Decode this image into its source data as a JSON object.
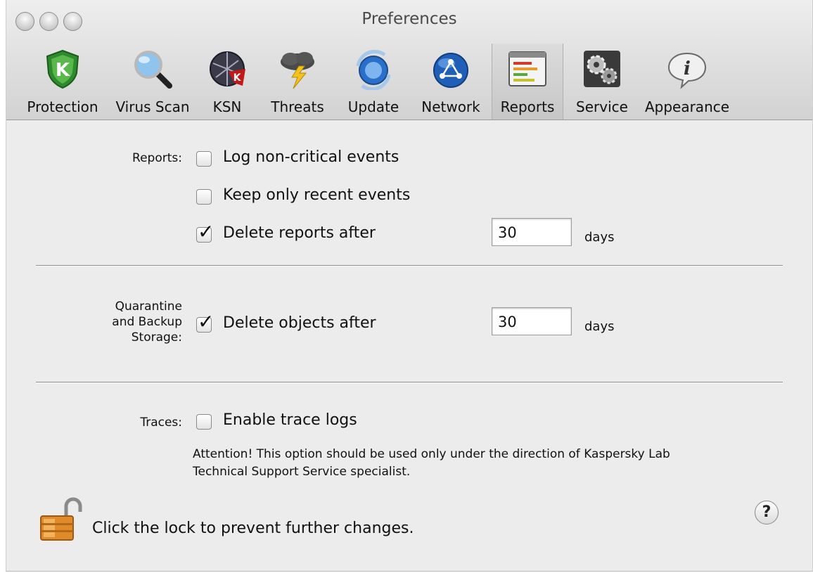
{
  "window": {
    "title": "Preferences"
  },
  "toolbar": {
    "items": [
      {
        "label": "Protection",
        "icon": "protection-shield-icon"
      },
      {
        "label": "Virus Scan",
        "icon": "magnifier-icon"
      },
      {
        "label": "KSN",
        "icon": "ksn-globe-icon"
      },
      {
        "label": "Threats",
        "icon": "storm-cloud-icon"
      },
      {
        "label": "Update",
        "icon": "update-globe-icon"
      },
      {
        "label": "Network",
        "icon": "network-icon"
      },
      {
        "label": "Reports",
        "icon": "reports-icon",
        "selected": true
      },
      {
        "label": "Service",
        "icon": "service-gears-icon"
      },
      {
        "label": "Appearance",
        "icon": "info-bubble-icon"
      }
    ]
  },
  "reports": {
    "label": "Reports:",
    "log_noncritical": {
      "label": "Log non-critical events",
      "checked": false
    },
    "keep_recent": {
      "label": "Keep only recent events",
      "checked": false
    },
    "delete_after": {
      "label": "Delete reports after",
      "checked": true,
      "value": "30",
      "unit": "days"
    }
  },
  "quarantine": {
    "label_lines": [
      "Quarantine",
      "and Backup",
      "Storage:"
    ],
    "delete_after": {
      "label": "Delete objects after",
      "checked": true,
      "value": "30",
      "unit": "days"
    }
  },
  "traces": {
    "label": "Traces:",
    "enable": {
      "label": "Enable trace logs",
      "checked": false
    },
    "note_line1": "Attention! This option should be used only under the direction of Kaspersky Lab",
    "note_line2": "Technical Support Service specialist."
  },
  "footer": {
    "lock_text": "Click the lock to prevent further changes.",
    "help_label": "?",
    "check_glyph": "✓"
  }
}
